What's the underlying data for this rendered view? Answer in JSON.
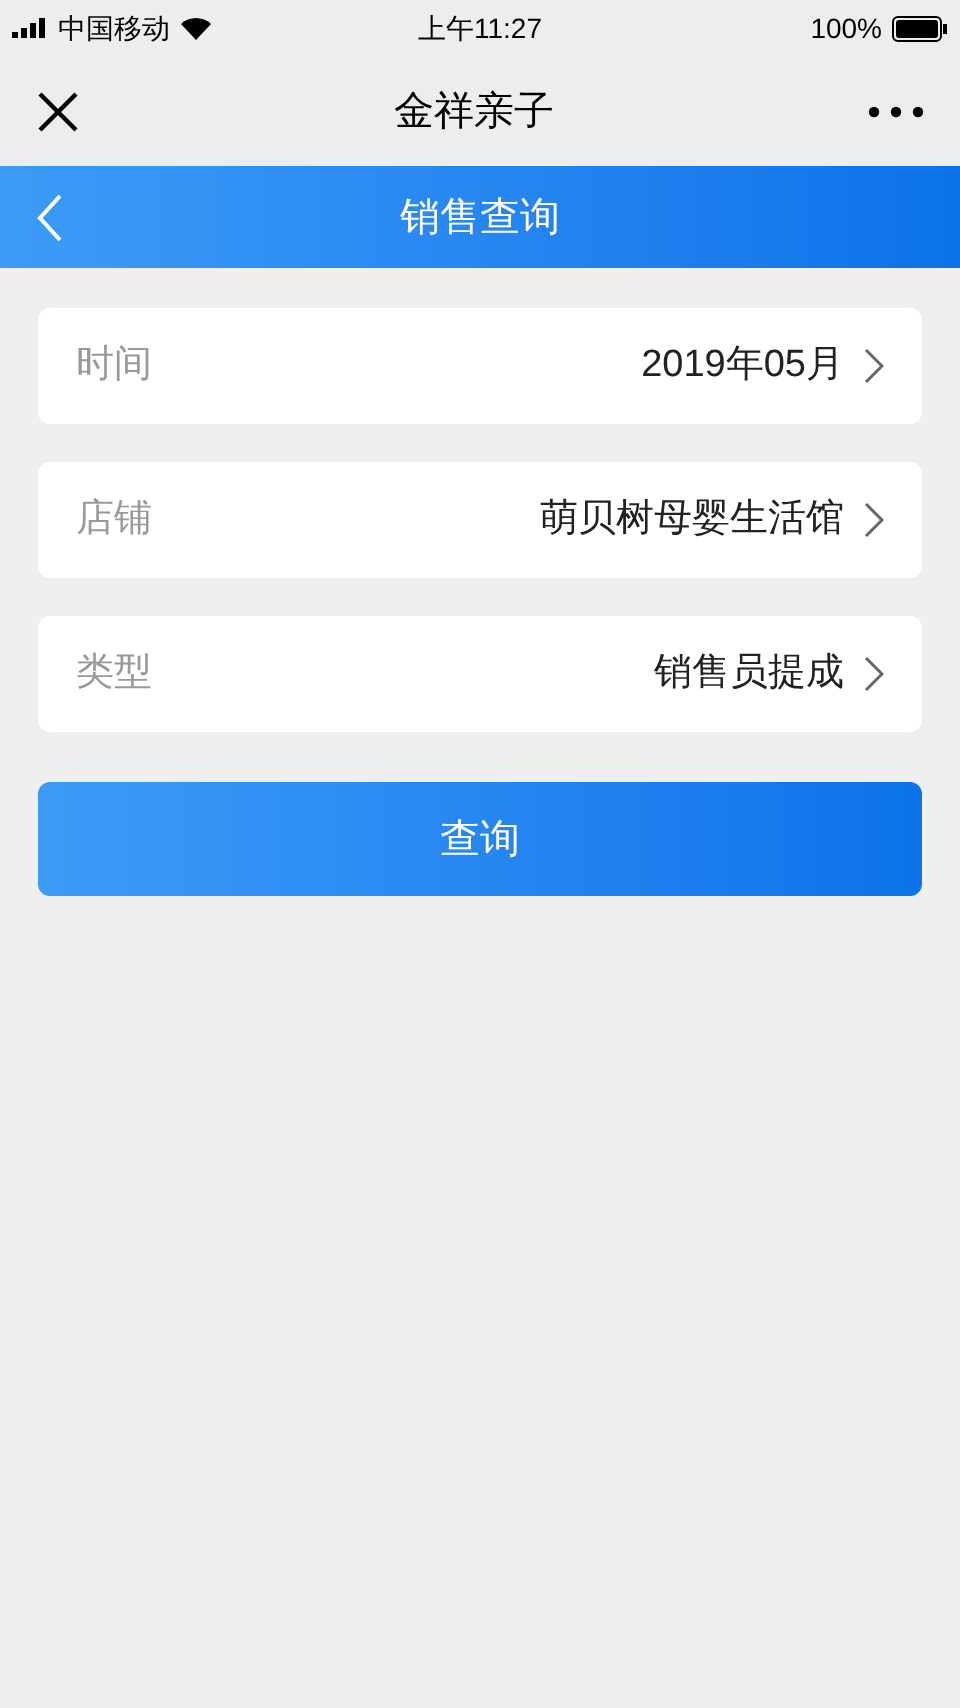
{
  "status_bar": {
    "carrier": "中国移动",
    "time": "上午11:27",
    "battery": "100%"
  },
  "nav_bar": {
    "title": "金祥亲子"
  },
  "header": {
    "title": "销售查询"
  },
  "fields": [
    {
      "label": "时间",
      "value": "2019年05月"
    },
    {
      "label": "店铺",
      "value": "萌贝树母婴生活馆"
    },
    {
      "label": "类型",
      "value": "销售员提成"
    }
  ],
  "button": {
    "label": "查询"
  }
}
